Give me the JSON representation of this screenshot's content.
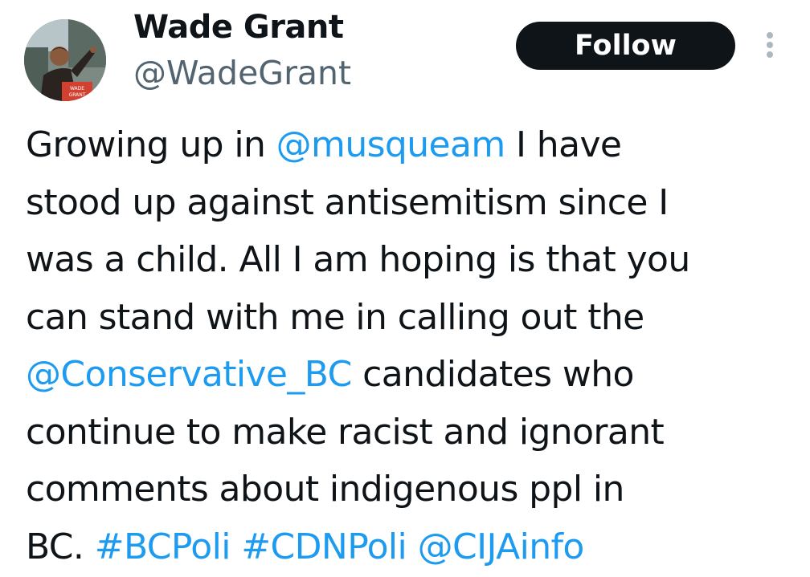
{
  "header": {
    "display_name": "Wade Grant",
    "handle": "@WadeGrant",
    "follow_label": "Follow",
    "avatar_sign_text": "WADE GRANT",
    "more_icon": "more-vertical-icon"
  },
  "tweet": {
    "lines": [
      [
        {
          "text": "Growing up in "
        },
        {
          "text": "@musqueam",
          "link": true
        },
        {
          "text": " I have"
        }
      ],
      [
        {
          "text": "stood up against antisemitism since I"
        }
      ],
      [
        {
          "text": "was a child. All I am hoping is that you"
        }
      ],
      [
        {
          "text": "can stand with me in calling out the"
        }
      ],
      [
        {
          "text": "@Conservative_BC",
          "link": true
        },
        {
          "text": " candidates who"
        }
      ],
      [
        {
          "text": "continue to make racist and ignorant"
        }
      ],
      [
        {
          "text": "comments about indigenous ppl in"
        }
      ],
      [
        {
          "text": "BC. "
        },
        {
          "text": "#BCPoli",
          "link": true
        },
        {
          "text": " "
        },
        {
          "text": "#CDNPoli",
          "link": true
        },
        {
          "text": " "
        },
        {
          "text": "@CIJAinfo",
          "link": true
        }
      ]
    ]
  },
  "colors": {
    "text": "#0f1419",
    "secondary": "#536471",
    "link": "#1d9bf0",
    "button_bg": "#0f1419"
  }
}
